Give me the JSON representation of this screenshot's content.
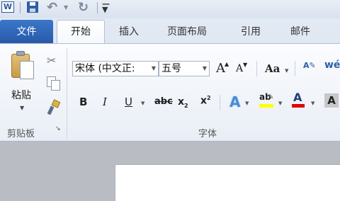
{
  "app": {
    "logo_letter": "W"
  },
  "tabs": {
    "file": "文件",
    "home": "开始",
    "insert": "插入",
    "page_layout": "页面布局",
    "references": "引用",
    "mailings": "邮件"
  },
  "clipboard": {
    "paste_label": "粘贴",
    "group_label": "剪贴板"
  },
  "font": {
    "font_name": "宋体 (中文正:",
    "font_size": "五号",
    "grow_label": "A",
    "shrink_label": "A",
    "change_case_label": "Aa",
    "bold_label": "B",
    "italic_label": "I",
    "underline_label": "U",
    "strike_label": "abc",
    "subscript_label": "x",
    "subscript_suffix": "2",
    "superscript_label": "x",
    "superscript_suffix": "2",
    "highlight_label": "ab",
    "font_color_label": "A",
    "shading_label": "A",
    "group_label": "字体"
  },
  "colors": {
    "file_tab": "#2b5fab",
    "highlight": "#ffff00",
    "font_color": "#e00000"
  }
}
